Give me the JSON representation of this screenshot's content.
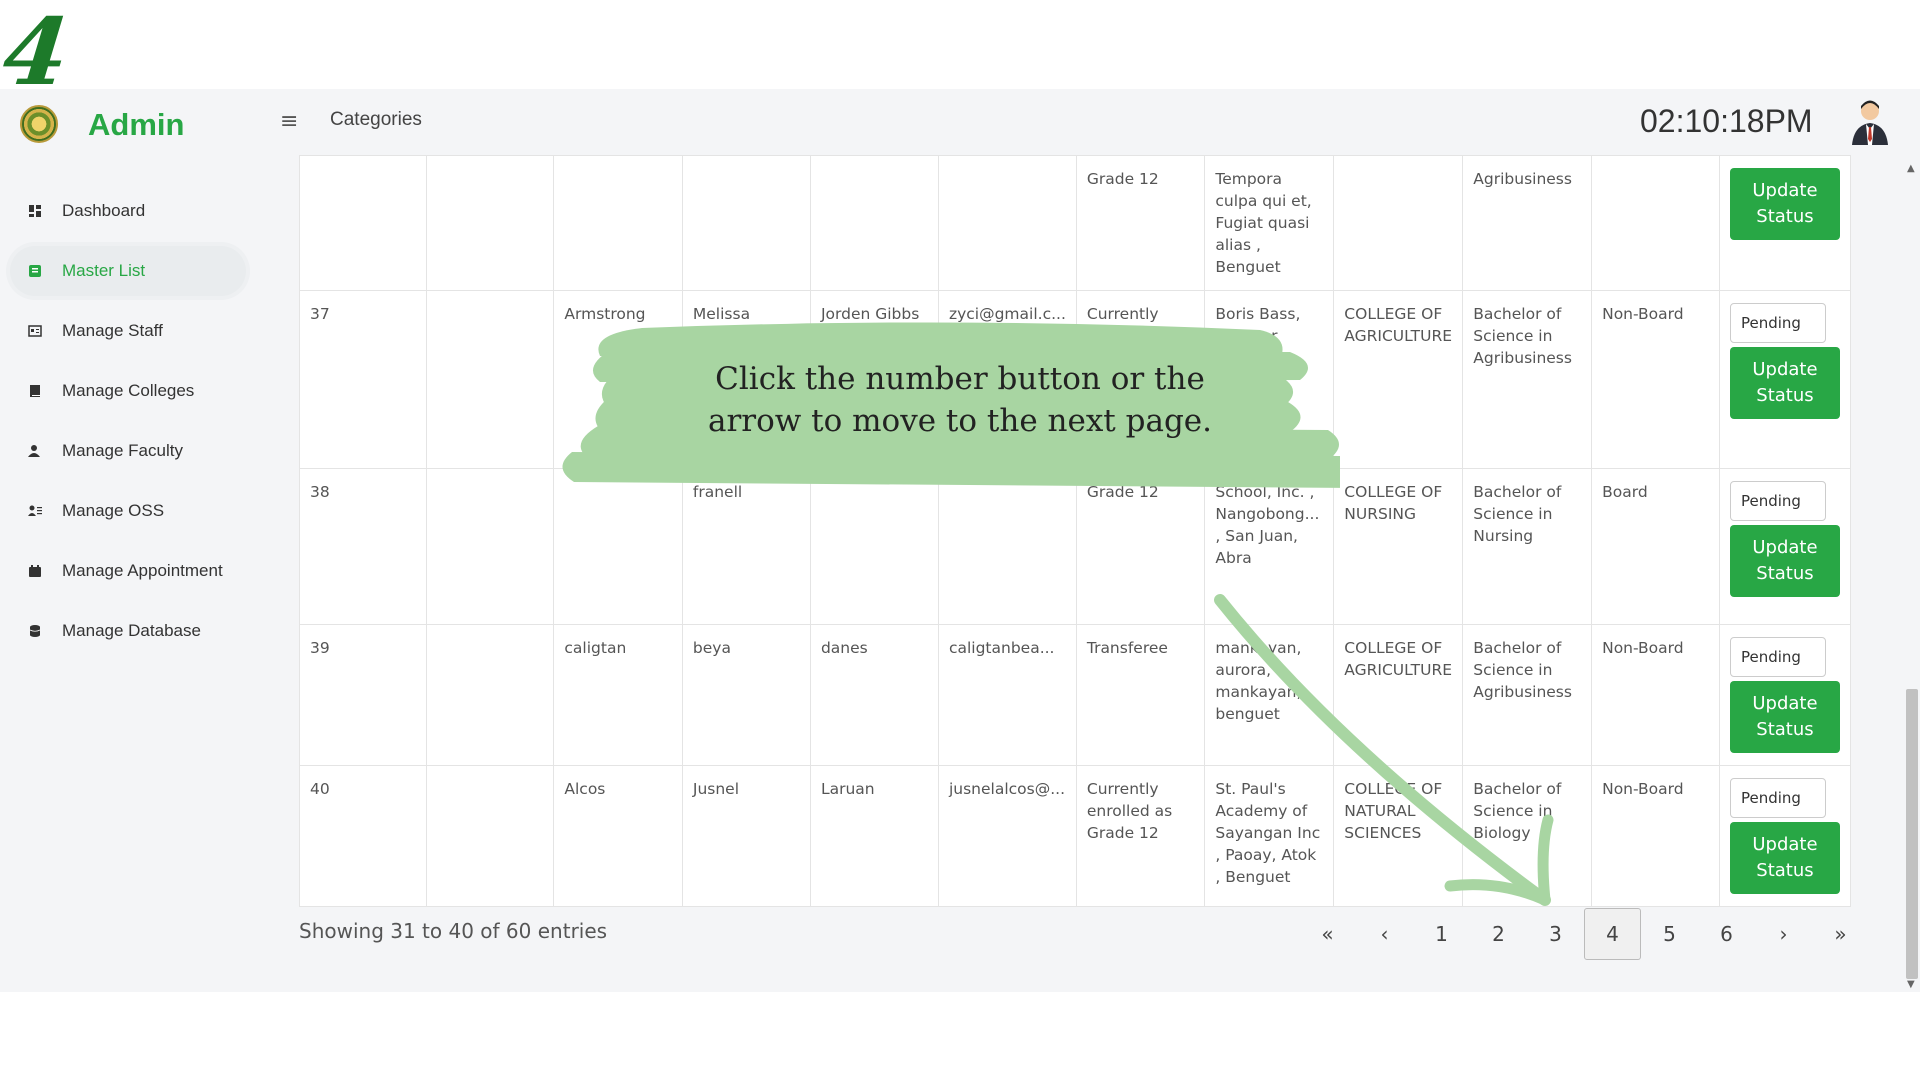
{
  "step": "4",
  "header": {
    "brand": "Admin",
    "page_title": "Categories",
    "clock": "02:10:18PM"
  },
  "sidebar": {
    "items": [
      {
        "label": "Dashboard",
        "icon": "dashboard-icon"
      },
      {
        "label": "Master List",
        "icon": "list-icon"
      },
      {
        "label": "Manage Staff",
        "icon": "id-card-icon"
      },
      {
        "label": "Manage Colleges",
        "icon": "book-icon"
      },
      {
        "label": "Manage Faculty",
        "icon": "user-icon"
      },
      {
        "label": "Manage OSS",
        "icon": "user-list-icon"
      },
      {
        "label": "Manage Appointment",
        "icon": "calendar-icon"
      },
      {
        "label": "Manage Database",
        "icon": "database-icon"
      }
    ],
    "active": "Master List"
  },
  "table": {
    "rows": [
      {
        "no": "",
        "last": "",
        "first": "",
        "middle": "",
        "email": "",
        "status": "Grade 12",
        "school": "Tempora culpa qui et, Fugiat quasi alias , Benguet",
        "college": "",
        "program": "Agribusiness",
        "type": "",
        "pending": "",
        "update": "Update Status"
      },
      {
        "no": "37",
        "last": "Armstrong",
        "first": "Melissa",
        "middle": "Jorden Gibbs",
        "email": "zyci@gmail.c...",
        "status": "Currently enrolled as",
        "school": "Boris Bass, Eu error",
        "college": "COLLEGE OF AGRICULTURE",
        "program": "Bachelor of Science in Agribusiness",
        "type": "Non-Board",
        "pending": "Pending",
        "update": "Update Status"
      },
      {
        "no": "38",
        "last": "",
        "first": "franell",
        "middle": "",
        "email": "",
        "status": "Grade 12",
        "school": "School, Inc. , Nangobong... , San Juan, Abra",
        "college": "COLLEGE OF NURSING",
        "program": "Bachelor of Science in Nursing",
        "type": "Board",
        "pending": "Pending",
        "update": "Update Status"
      },
      {
        "no": "39",
        "last": "caligtan",
        "first": "beya",
        "middle": "danes",
        "email": "caligtanbea...",
        "status": "Transferee",
        "school": "mankayan, aurora, mankayan, benguet",
        "college": "COLLEGE OF AGRICULTURE",
        "program": "Bachelor of Science in Agribusiness",
        "type": "Non-Board",
        "pending": "Pending",
        "update": "Update Status"
      },
      {
        "no": "40",
        "last": "Alcos",
        "first": "Jusnel",
        "middle": "Laruan",
        "email": "jusnelalcos@...",
        "status": "Currently enrolled as Grade 12",
        "school": "St. Paul's Academy of Sayangan Inc , Paoay, Atok , Benguet",
        "college": "COLLEGE OF NATURAL SCIENCES",
        "program": "Bachelor of Science in Biology",
        "type": "Non-Board",
        "pending": "Pending",
        "update": "Update Status"
      }
    ]
  },
  "footer": {
    "info": "Showing 31 to 40 of 60 entries",
    "pages": [
      "«",
      "‹",
      "1",
      "2",
      "3",
      "4",
      "5",
      "6",
      "›",
      "»"
    ],
    "current_page": "4"
  },
  "callout": {
    "text": "Click the number button or the arrow to move to the next page."
  },
  "colors": {
    "accent": "#28a745",
    "callout": "#a8d5a2",
    "step": "#1d7a2a"
  }
}
